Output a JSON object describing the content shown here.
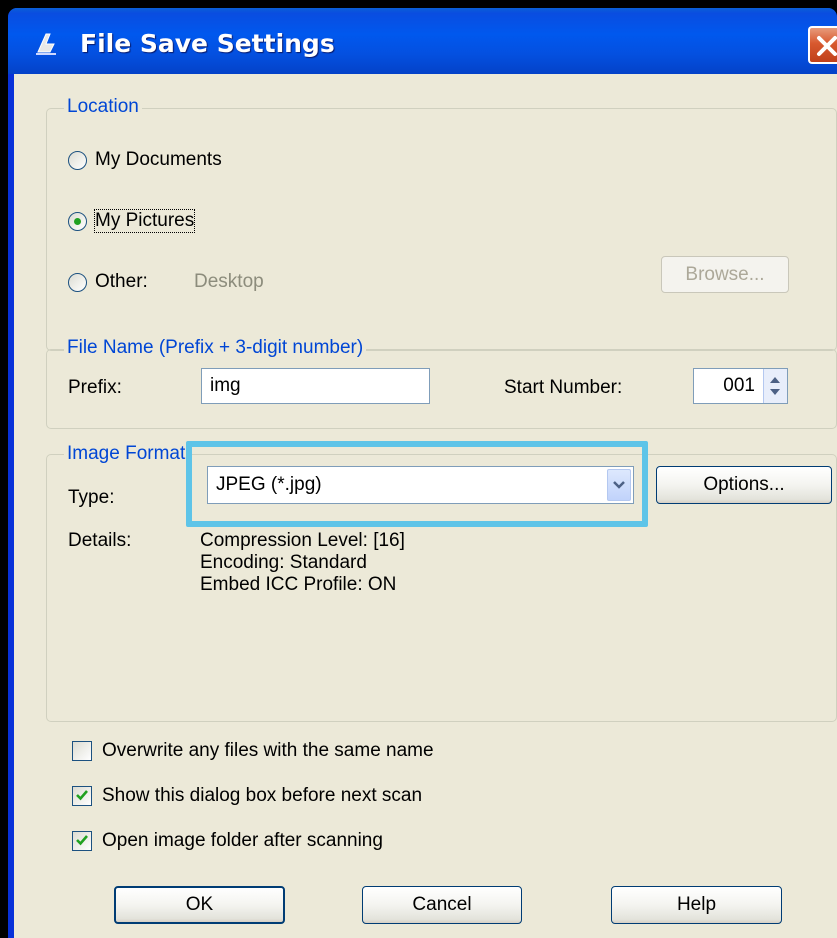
{
  "window": {
    "title": "File Save Settings"
  },
  "location": {
    "legend": "Location",
    "options": [
      {
        "label": "My Documents",
        "selected": false
      },
      {
        "label": "My Pictures",
        "selected": true
      },
      {
        "label": "Other:",
        "selected": false
      }
    ],
    "other_path": "Desktop",
    "browse_label": "Browse..."
  },
  "file_name": {
    "legend": "File Name (Prefix + 3-digit number)",
    "prefix_label": "Prefix:",
    "prefix_value": "img",
    "start_number_label": "Start Number:",
    "start_number_value": "001"
  },
  "image_format": {
    "legend": "Image Format",
    "type_label": "Type:",
    "type_value": "JPEG (*.jpg)",
    "options_label": "Options...",
    "details_label": "Details:",
    "details": [
      "Compression Level: [16]",
      "Encoding: Standard",
      "Embed ICC Profile: ON"
    ]
  },
  "checkboxes": [
    {
      "label": "Overwrite any files with the same name",
      "checked": false
    },
    {
      "label": "Show this dialog box before next scan",
      "checked": true
    },
    {
      "label": "Open image folder after scanning",
      "checked": true
    }
  ],
  "buttons": {
    "ok": "OK",
    "cancel": "Cancel",
    "help": "Help"
  },
  "colors": {
    "title_bar": "#0058EE",
    "dialog_bg": "#ECE9D8",
    "group_label": "#0046D5",
    "highlight": "#5EC4E8",
    "close_button": "#D8592F"
  }
}
